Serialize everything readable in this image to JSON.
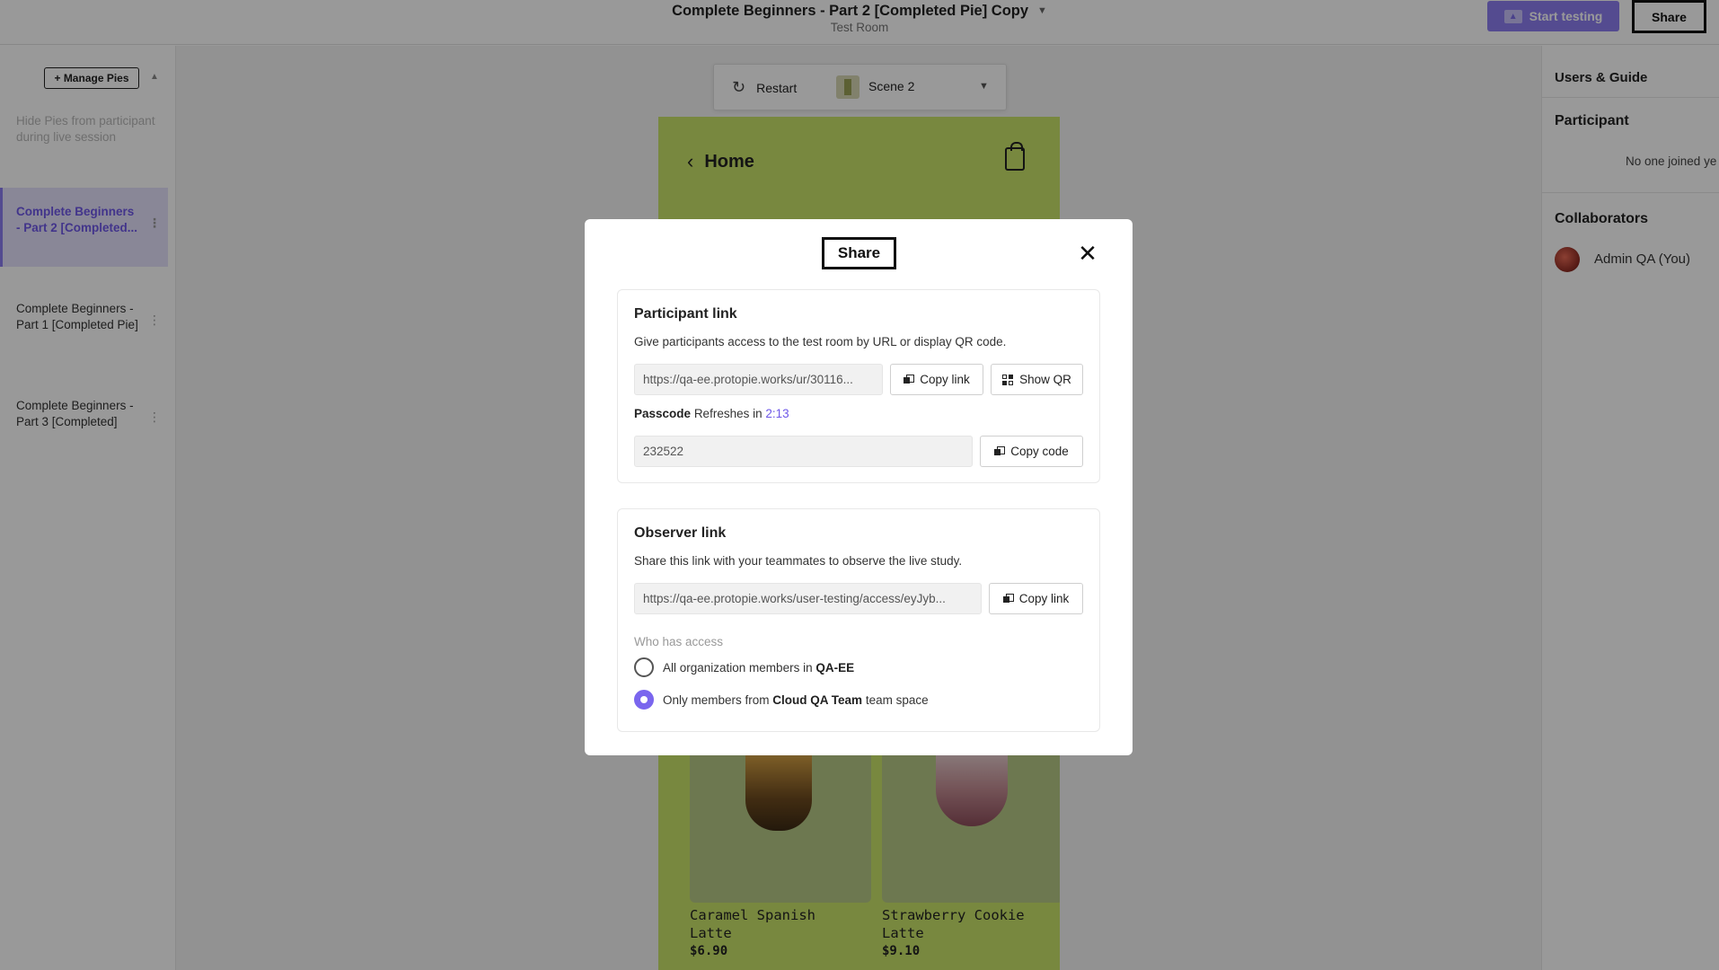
{
  "topbar": {
    "title": "Complete Beginners - Part 2 [Completed Pie] Copy",
    "subtitle": "Test Room",
    "start_testing": "Start testing",
    "share": "Share"
  },
  "sidebar": {
    "manage_pies": "Manage Pies",
    "hide_note": "Hide Pies from participant during live session",
    "items": [
      {
        "label": "Complete Beginners - Part 2 [Completed...",
        "active": true
      },
      {
        "label": "Complete Beginners - Part 1 [Completed Pie]",
        "active": false
      },
      {
        "label": "Complete Beginners - Part 3 [Completed]",
        "active": false
      }
    ]
  },
  "scene_bar": {
    "restart": "Restart",
    "scene": "Scene 2"
  },
  "phone": {
    "back_label": "Home",
    "products": [
      {
        "name": "Caramel Spanish Latte",
        "price": "$6.90"
      },
      {
        "name": "Strawberry Cookie Latte",
        "price": "$9.10"
      }
    ]
  },
  "right_panel": {
    "heading": "Users & Guide",
    "participant_heading": "Participant",
    "participant_empty": "No one joined ye",
    "collaborators_heading": "Collaborators",
    "collaborator_name": "Admin QA (You)"
  },
  "modal": {
    "title": "Share",
    "participant": {
      "title": "Participant link",
      "description": "Give participants access to the test room by URL or display QR code.",
      "url": "https://qa-ee.protopie.works/ur/30116...",
      "copy_link": "Copy link",
      "show_qr": "Show QR",
      "passcode_label": "Passcode",
      "refresh_text": "Refreshes in",
      "timer": "2:13",
      "code": "232522",
      "copy_code": "Copy code"
    },
    "observer": {
      "title": "Observer link",
      "description": "Share this link with your teammates to observe the live study.",
      "url": "https://qa-ee.protopie.works/user-testing/access/eyJyb...",
      "copy_link": "Copy link",
      "access_label": "Who has access",
      "option1_prefix": "All organization members in",
      "option1_bold": "QA-EE",
      "option2_prefix": "Only members from",
      "option2_bold": "Cloud QA Team",
      "option2_suffix": "team space",
      "selected": "option2"
    }
  },
  "colors": {
    "accent": "#7a66ee",
    "phone_bg": "#c9e36a"
  }
}
